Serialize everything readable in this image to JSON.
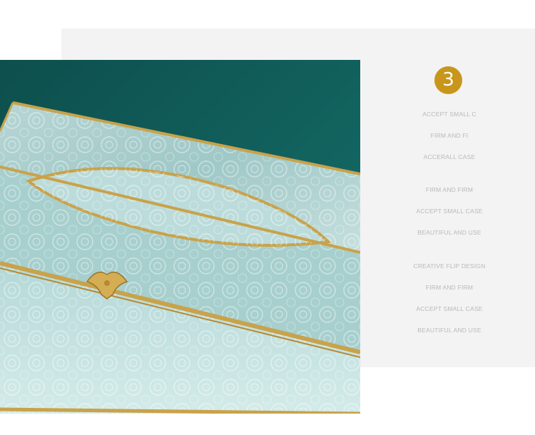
{
  "badge": {
    "number": "3",
    "color": "#c8961a"
  },
  "captions": [
    "ACCEPT SMALL C",
    "FIRM AND FI",
    "ACCERALL CASE",
    "FIRM AND FIRM",
    "ACCEPT SMALL CASE",
    "BEAUTIFUL AND USE",
    "CREATIVE FLIP DESIGN",
    "FIRM AND FIRM",
    "ACCEPT SMALL CASE",
    "BEAUTIFUL AND USE"
  ],
  "colors": {
    "background_wall": "#0f5a57",
    "glass": "#a9cfcf",
    "gold_trim": "#c9a24a",
    "panel": "#f3f3f3"
  }
}
